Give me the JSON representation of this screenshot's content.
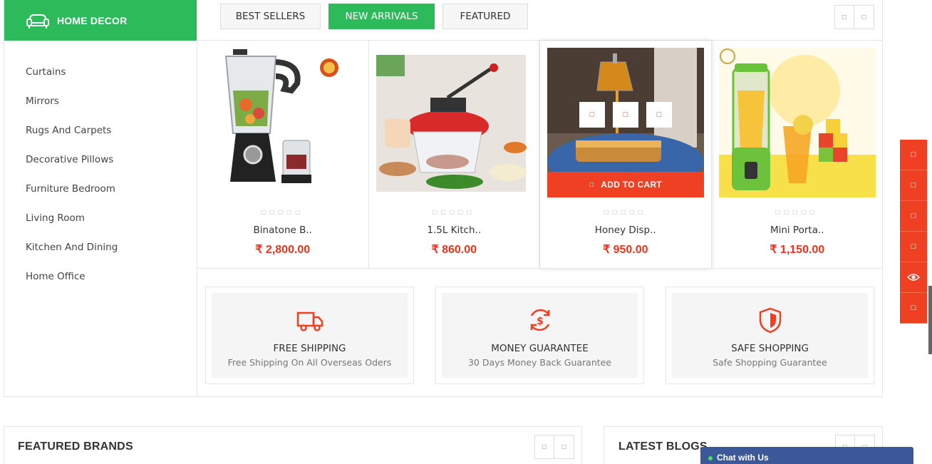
{
  "category_panel": {
    "title": "HOME DECOR",
    "icon": "sofa-icon",
    "items": [
      {
        "label": "Curtains"
      },
      {
        "label": "Mirrors"
      },
      {
        "label": "Rugs And Carpets"
      },
      {
        "label": "Decorative Pillows"
      },
      {
        "label": "Furniture Bedroom"
      },
      {
        "label": "Living Room"
      },
      {
        "label": "Kitchen And Dining"
      },
      {
        "label": "Home Office"
      }
    ]
  },
  "tabs": [
    {
      "label": "BEST SELLERS",
      "active": false
    },
    {
      "label": "NEW ARRIVALS",
      "active": true
    },
    {
      "label": "FEATURED",
      "active": false
    }
  ],
  "products": [
    {
      "name": "Binatone B..",
      "price": "₹ 2,800.00",
      "rating": 0
    },
    {
      "name": "1.5L Kitch..",
      "price": "₹ 860.00",
      "rating": 0
    },
    {
      "name": "Honey Disp..",
      "price": "₹ 950.00",
      "rating": 0,
      "add_to_cart": "ADD TO CART"
    },
    {
      "name": "Mini Porta..",
      "price": "₹ 1,150.00",
      "rating": 0
    }
  ],
  "features": [
    {
      "title": "FREE SHIPPING",
      "subtitle": "Free Shipping On All Overseas Oders",
      "icon": "truck-icon"
    },
    {
      "title": "MONEY GUARANTEE",
      "subtitle": "30 Days Money Back Guarantee",
      "icon": "money-cycle-icon"
    },
    {
      "title": "SAFE SHOPPING",
      "subtitle": "Safe Shopping Guarantee",
      "icon": "shield-icon"
    }
  ],
  "sections": {
    "brands_title": "FEATURED BRANDS",
    "blogs_title": "LATEST BLOGS"
  },
  "chat": {
    "label": "Chat with Us"
  },
  "colors": {
    "green": "#2dba5a",
    "accent_red": "#f04023",
    "price_red": "#e8361e",
    "chat_blue": "#3b5998"
  }
}
